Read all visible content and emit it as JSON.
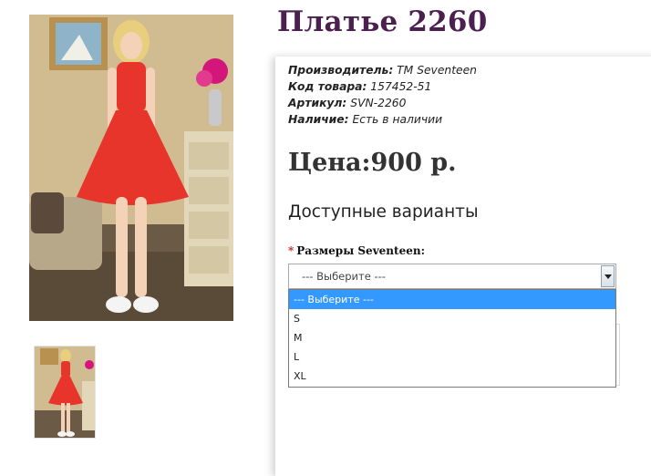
{
  "product": {
    "title": "Платье 2260",
    "meta": [
      {
        "label": "Производитель:",
        "value": " TM Seventeen"
      },
      {
        "label": "Код товара:",
        "value": " 157452-51"
      },
      {
        "label": "Артикул:",
        "value": " SVN-2260"
      },
      {
        "label": "Наличие:",
        "value": " Есть в наличии"
      }
    ],
    "price_label": "Цена:",
    "price_value": "900 р.",
    "variants_heading": "Доступные варианты",
    "option": {
      "required_mark": "*",
      "label": "Размеры Seventeen:",
      "selected": "--- Выберите ---",
      "options": [
        "--- Выберите ---",
        "S",
        "M",
        "L",
        "XL"
      ]
    }
  },
  "colors": {
    "title": "#4b1f4f",
    "dress": "#e8352c",
    "highlight": "#3399ff"
  }
}
